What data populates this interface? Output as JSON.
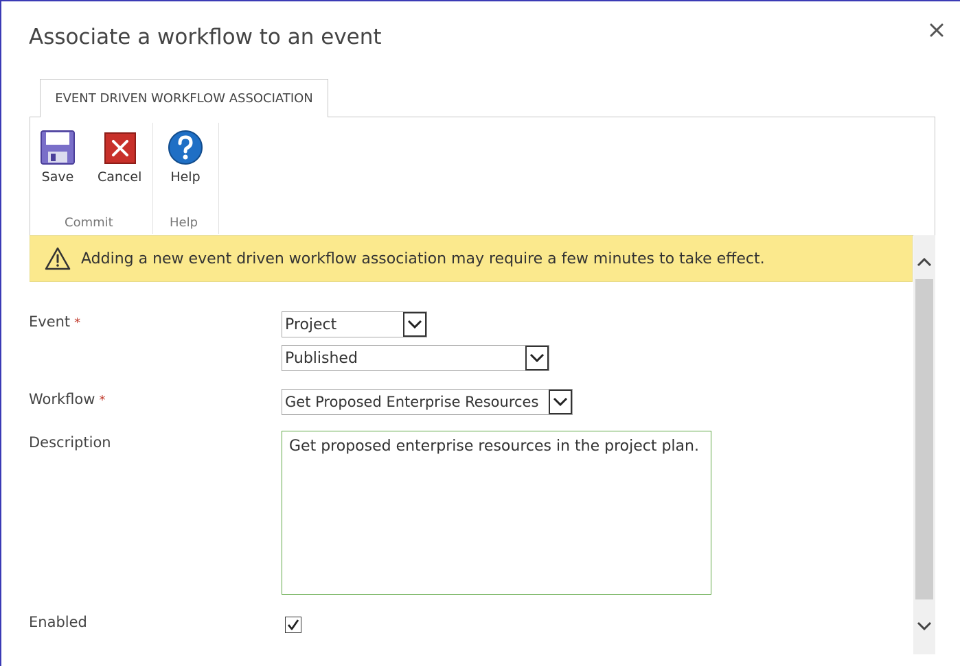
{
  "dialog": {
    "title": "Associate a workflow to an event"
  },
  "ribbon": {
    "tab_label": "EVENT DRIVEN WORKFLOW ASSOCIATION",
    "buttons": {
      "save": "Save",
      "cancel": "Cancel",
      "help": "Help"
    },
    "groups": {
      "commit": "Commit",
      "help": "Help"
    }
  },
  "notice": {
    "text": "Adding a new event driven workflow association may require a few minutes to take effect."
  },
  "form": {
    "event": {
      "label": "Event",
      "required_mark": "*",
      "object_value": "Project",
      "action_value": "Published"
    },
    "workflow": {
      "label": "Workflow",
      "required_mark": "*",
      "value": "Get Proposed Enterprise Resources"
    },
    "description": {
      "label": "Description",
      "value": "Get proposed enterprise resources in the project plan."
    },
    "enabled": {
      "label": "Enabled",
      "checked": true
    }
  },
  "icons": {
    "close": "close-icon",
    "save": "floppy-disk-icon",
    "cancel": "cancel-x-icon",
    "help": "help-question-icon",
    "warning": "warning-triangle-icon",
    "dropdown": "chevron-down-icon",
    "scroll_up": "chevron-up-icon",
    "scroll_down": "chevron-down-icon",
    "checkmark": "checkmark-icon"
  },
  "colors": {
    "frame_border": "#3b3bb5",
    "notice_background": "#fbe98d",
    "required": "#c0392b",
    "textarea_border": "#5fa845",
    "help_icon": "#1f6fc5",
    "cancel_icon": "#c8302a"
  }
}
